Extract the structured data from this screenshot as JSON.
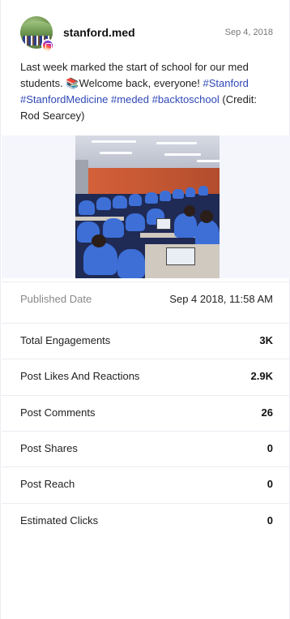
{
  "post": {
    "username": "stanford.med",
    "date": "Sep 4, 2018",
    "caption_text": "Last week marked the start of school for our med students. ",
    "caption_emoji": "📚",
    "caption_text2": "Welcome back, everyone! ",
    "hashtags": [
      "#Stanford",
      "#StanfordMedicine",
      "#meded",
      "#backtoschool"
    ],
    "caption_credit": "(Credit: Rod Searcey)",
    "image_alt": "Lecture hall of medical students in blue shirts"
  },
  "published": {
    "label": "Published Date",
    "value": "Sep 4 2018, 11:58 AM"
  },
  "stats": [
    {
      "label": "Total Engagements",
      "value": "3K"
    },
    {
      "label": "Post Likes And Reactions",
      "value": "2.9K"
    },
    {
      "label": "Post Comments",
      "value": "26"
    },
    {
      "label": "Post Shares",
      "value": "0"
    },
    {
      "label": "Post Reach",
      "value": "0"
    },
    {
      "label": "Estimated Clicks",
      "value": "0"
    }
  ],
  "colors": {
    "hashtag": "#2f48b6",
    "divider": "#ececf2",
    "media_bg": "#f4f6fc"
  },
  "icons": [
    "instagram-badge-icon"
  ]
}
